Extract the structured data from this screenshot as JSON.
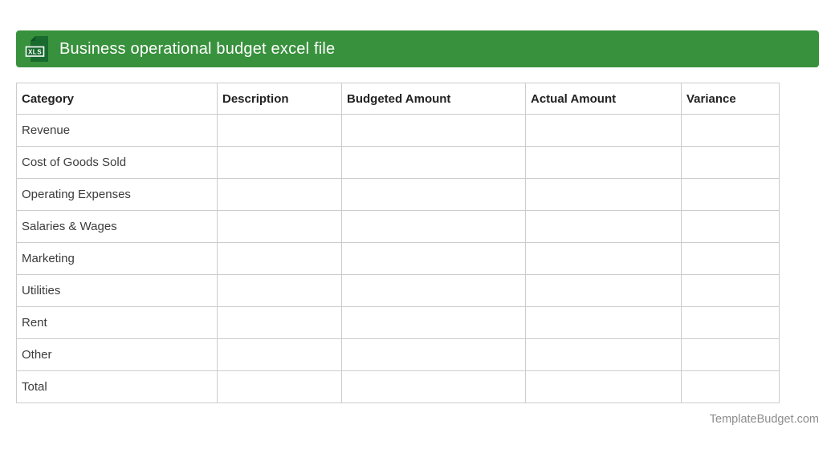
{
  "header": {
    "title": "Business operational budget excel file",
    "icon_label": "XLS",
    "bar_color": "#38913c",
    "icon_color": "#186a2e"
  },
  "table": {
    "columns": [
      "Category",
      "Description",
      "Budgeted Amount",
      "Actual Amount",
      "Variance"
    ],
    "rows": [
      "Revenue",
      "Cost of Goods Sold",
      "Operating Expenses",
      "Salaries & Wages",
      "Marketing",
      "Utilities",
      "Rent",
      "Other",
      "Total"
    ],
    "empty_cell": ""
  },
  "footer": {
    "site_name": "TemplateBudget.com"
  }
}
